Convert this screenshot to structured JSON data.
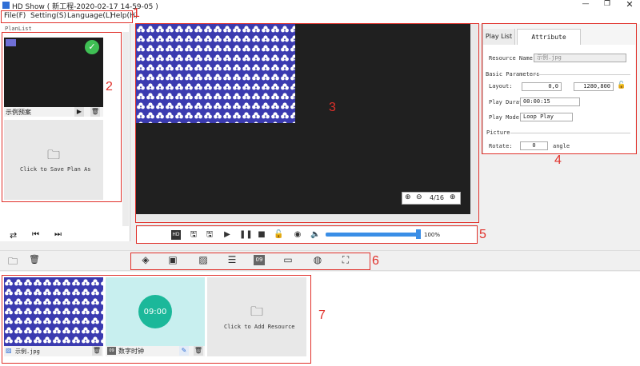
{
  "window": {
    "title": "HD Show ( 新工程-2020-02-17 14-59-05 )",
    "controls": [
      "minimize",
      "maximize",
      "close"
    ]
  },
  "menu": [
    "File(F)",
    "Setting(S)",
    "Language(L)",
    "Help(H)"
  ],
  "annotations": [
    "1",
    "2",
    "3",
    "4",
    "5",
    "6",
    "7"
  ],
  "plan_list": {
    "title": "PlanList",
    "plan_name": "示例预案",
    "add_plan_label": "Click to Save Plan As",
    "bottom_controls": [
      "loop-icon",
      "prev-icon",
      "next-icon"
    ]
  },
  "preview": {
    "page_indicator": "4/16"
  },
  "playback": {
    "volume_label": "100%",
    "volume_level": 1.0
  },
  "attributes": {
    "tabs": [
      "Play List",
      "Attribute Setting"
    ],
    "active_tab": 1,
    "resource_name_label": "Resource Name:",
    "resource_name_value": "示例.jpg",
    "basic_params_label": "Basic Parameters",
    "layout_label": "Layout:",
    "layout_pos": "0,0",
    "layout_size": "1280,800",
    "duration_label": "Play Duration:",
    "duration_value": "00:00:15",
    "mode_label": "Play Mode:",
    "mode_value": "Loop Play",
    "picture_label": "Picture",
    "rotate_label": "Rotate:",
    "rotate_value": "0",
    "rotate_unit": "angle"
  },
  "resources": {
    "items": [
      {
        "name": "示例.jpg"
      },
      {
        "name": "数字时钟",
        "clock_text": "09:00"
      }
    ],
    "add_label": "Click to Add Resource"
  },
  "colors": {
    "accent_blue": "#3a8ee6",
    "annotation_red": "#e0302a",
    "check_green": "#3fbf54",
    "clock_teal": "#1bb89a",
    "clock_bg": "#c8efef",
    "pattern_blue": "#3b3bb0"
  }
}
